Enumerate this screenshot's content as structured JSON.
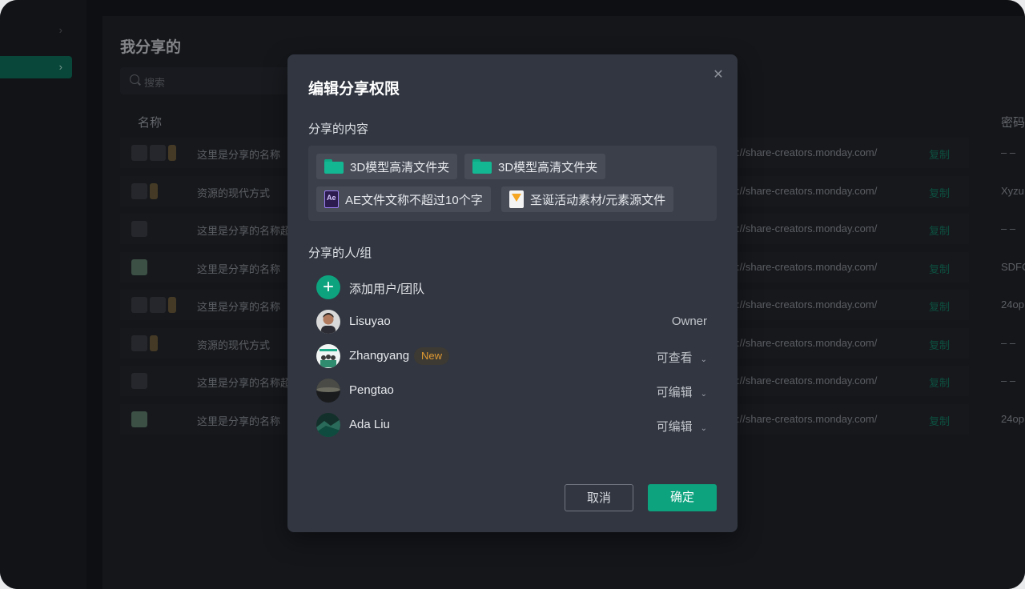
{
  "page": {
    "title": "我分享的",
    "search_placeholder": "搜索"
  },
  "table": {
    "columns": {
      "name": "名称",
      "password": "密码"
    },
    "copy_label": "复制",
    "rows": [
      {
        "name": "这里是分享的名称",
        "url": "://share-creators.monday.com/",
        "password": "– –"
      },
      {
        "name": "资源的现代方式",
        "url": "://share-creators.monday.com/",
        "password": "Xyzu"
      },
      {
        "name": "这里是分享的名称超出",
        "url": "://share-creators.monday.com/",
        "password": "– –"
      },
      {
        "name": "这里是分享的名称",
        "url": "://share-creators.monday.com/",
        "password": "SDFC"
      },
      {
        "name": "这里是分享的名称",
        "url": "://share-creators.monday.com/",
        "password": "24op"
      },
      {
        "name": "资源的现代方式",
        "url": "://share-creators.monday.com/",
        "password": "– –"
      },
      {
        "name": "这里是分享的名称超出",
        "url": "://share-creators.monday.com/",
        "password": "– –"
      },
      {
        "name": "这里是分享的名称",
        "url": "://share-creators.monday.com/",
        "password": "24op"
      }
    ]
  },
  "modal": {
    "title": "编辑分享权限",
    "content_label": "分享的内容",
    "items": [
      {
        "name": "3D模型高清文件夹",
        "icon": "folder-icon"
      },
      {
        "name": "3D模型高清文件夹",
        "icon": "folder-icon"
      },
      {
        "name": "AE文件文称不超过10个字",
        "icon": "after-effects-file-icon",
        "icon_text": "Ae"
      },
      {
        "name": "圣诞活动素材/元素源文件",
        "icon": "sketch-file-icon"
      }
    ],
    "people_label": "分享的人/组",
    "add_label": "添加用户/团队",
    "people": [
      {
        "name": "Lisuyao",
        "role": "Owner"
      },
      {
        "name": "Zhangyang",
        "badge": "New",
        "role": "可查看"
      },
      {
        "name": "Pengtao",
        "role": "可编辑"
      },
      {
        "name": "Ada Liu",
        "role": "可编辑"
      }
    ],
    "cancel": "取消",
    "confirm": "确定"
  },
  "colors": {
    "accent": "#0ea37f",
    "modal_bg": "#313640",
    "badge_text": "#e19a32"
  }
}
